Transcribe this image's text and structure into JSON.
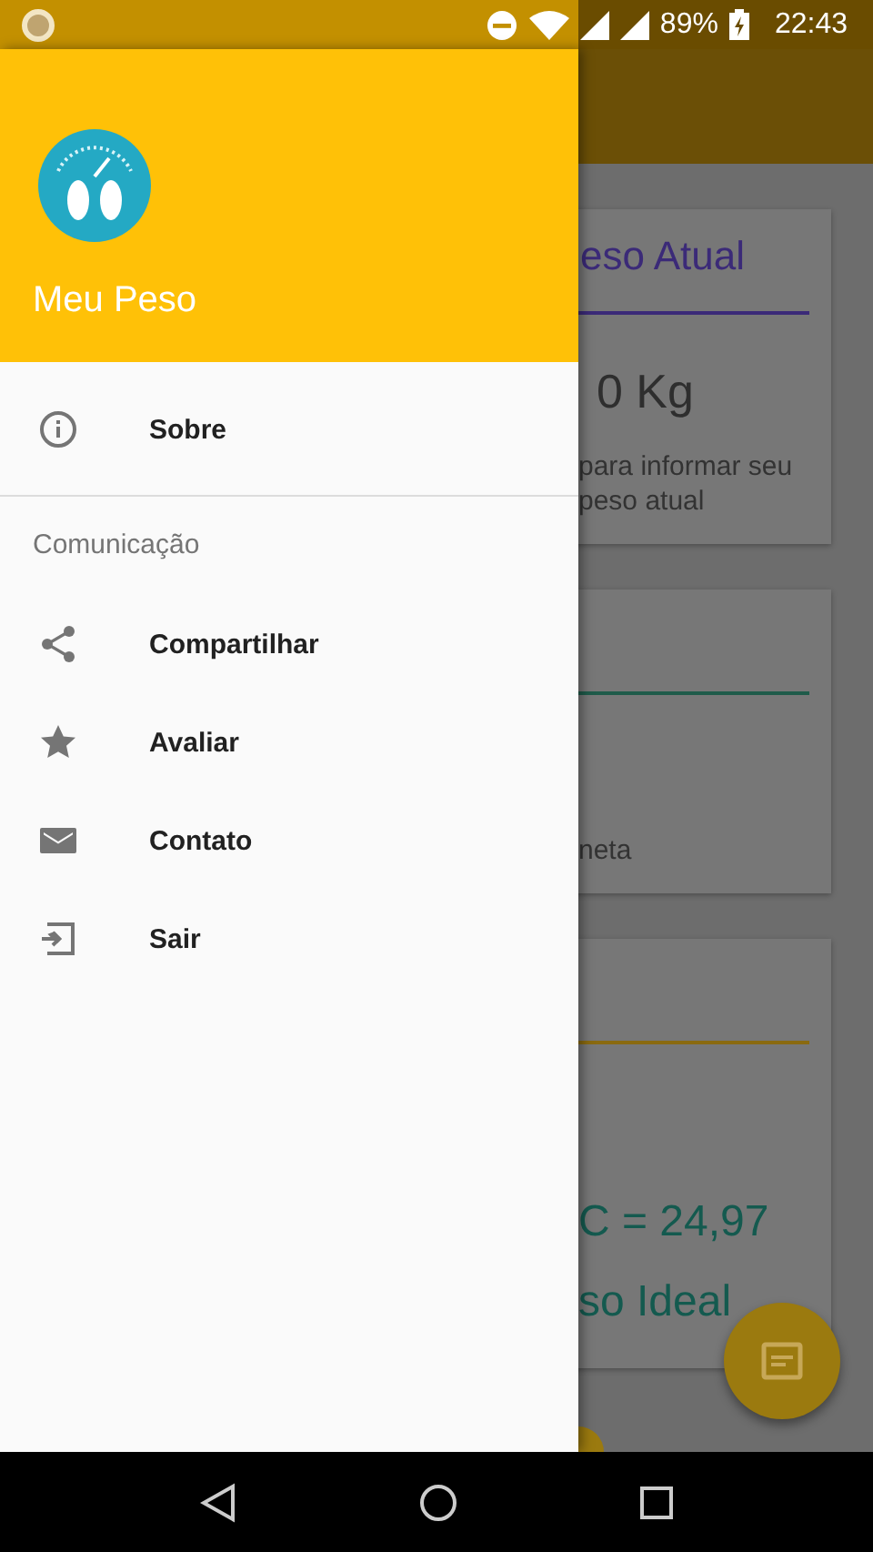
{
  "status_bar": {
    "battery": "89%",
    "time": "22:43"
  },
  "drawer": {
    "header": {
      "title": "Meu Peso"
    },
    "items": [
      {
        "kind": "info",
        "label": "Sobre"
      }
    ],
    "sections": [
      {
        "title": "Comunicação",
        "items": [
          {
            "kind": "share",
            "label": "Compartilhar"
          },
          {
            "kind": "star",
            "label": "Avaliar"
          },
          {
            "kind": "mail",
            "label": "Contato"
          },
          {
            "kind": "exit",
            "label": "Sair"
          }
        ]
      }
    ]
  },
  "background": {
    "cards": [
      {
        "color": "#3b2a78",
        "texts": [
          {
            "kind": "title",
            "text": "eso Atual"
          },
          {
            "kind": "divider"
          },
          {
            "kind": "value",
            "text": "0 Kg"
          },
          {
            "kind": "note",
            "text": "para informar seu"
          },
          {
            "kind": "note",
            "text": "peso atual"
          }
        ]
      },
      {
        "color": "#1f5b4a",
        "texts": [
          {
            "kind": "blank"
          },
          {
            "kind": "divider"
          },
          {
            "kind": "gap"
          },
          {
            "kind": "note",
            "text": "neta"
          }
        ]
      },
      {
        "color": "#8a6a10",
        "texts": [
          {
            "kind": "blank"
          },
          {
            "kind": "divider"
          },
          {
            "kind": "gap"
          },
          {
            "kind": "result",
            "text": "C = 24,97"
          },
          {
            "kind": "result",
            "text": "so Ideal"
          }
        ]
      }
    ]
  }
}
